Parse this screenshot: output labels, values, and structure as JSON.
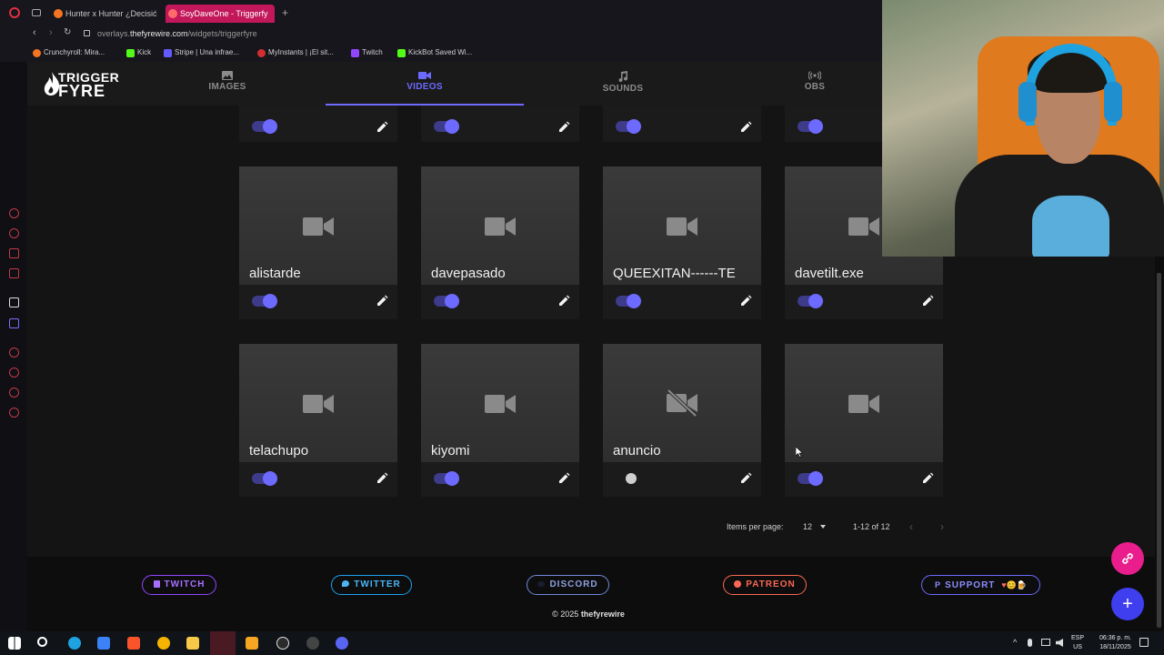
{
  "browser": {
    "tabs": [
      {
        "title": "Hunter x Hunter ¿Decisió",
        "active": false
      },
      {
        "title": "SoyDaveOne - Triggerfy",
        "active": true
      }
    ],
    "address": {
      "prefix": "overlays.",
      "domain": "thefyrewire.com",
      "path": "/widgets/triggerfyre"
    },
    "bookmarks": [
      {
        "label": "Crunchyroll: Mira..."
      },
      {
        "label": "Kick"
      },
      {
        "label": "Stripe | Una infrae..."
      },
      {
        "label": "MyInstants | ¡El sit..."
      },
      {
        "label": "Twitch"
      },
      {
        "label": "KickBot Saved Wi..."
      }
    ]
  },
  "app": {
    "logo_line1": "TRIGGER",
    "logo_line2": "FYRE",
    "nav": [
      {
        "label": "IMAGES",
        "icon": "image-icon",
        "active": false
      },
      {
        "label": "VIDEOS",
        "icon": "video-icon",
        "active": true
      },
      {
        "label": "SOUNDS",
        "icon": "music-note-icon",
        "active": false
      },
      {
        "label": "OBS",
        "icon": "broadcast-icon",
        "active": false
      }
    ]
  },
  "cards_top_row": [
    {
      "enabled": true
    },
    {
      "enabled": true
    },
    {
      "enabled": true
    },
    {
      "enabled": true
    }
  ],
  "cards": [
    {
      "name": "alistarde",
      "enabled": true,
      "video": true
    },
    {
      "name": "davepasado",
      "enabled": true,
      "video": true
    },
    {
      "name": "QUEEXITAN------TE",
      "enabled": true,
      "video": true
    },
    {
      "name": "davetilt.exe",
      "enabled": true,
      "video": true
    },
    {
      "name": "telachupo",
      "enabled": true,
      "video": true
    },
    {
      "name": "kiyomi",
      "enabled": true,
      "video": true
    },
    {
      "name": "anuncio",
      "enabled": false,
      "video": false
    },
    {
      "name": "",
      "enabled": true,
      "video": true
    }
  ],
  "pagination": {
    "items_per_page_label": "Items per page:",
    "items_per_page_value": "12",
    "range": "1-12 of 12"
  },
  "footer": {
    "buttons": [
      {
        "label": "TWITCH",
        "color": "#9146ff"
      },
      {
        "label": "TWITTER",
        "color": "#1da1f2"
      },
      {
        "label": "DISCORD",
        "color": "#7289da"
      },
      {
        "label": "PATREON",
        "color": "#f96854"
      },
      {
        "label": "SUPPORT",
        "color": "#6d6aff"
      }
    ],
    "support_emoji": "♥😊🍺",
    "copyright_prefix": "© 2025",
    "copyright_brand": "thefyrewire"
  },
  "colors": {
    "accent": "#6d6aff",
    "pink_fab": "#e91e8c",
    "blue_fab": "#3f3ff0"
  },
  "taskbar": {
    "lang1": "ESP",
    "lang2": "US",
    "time": "06:36 p. m.",
    "date": "18/11/2025"
  }
}
